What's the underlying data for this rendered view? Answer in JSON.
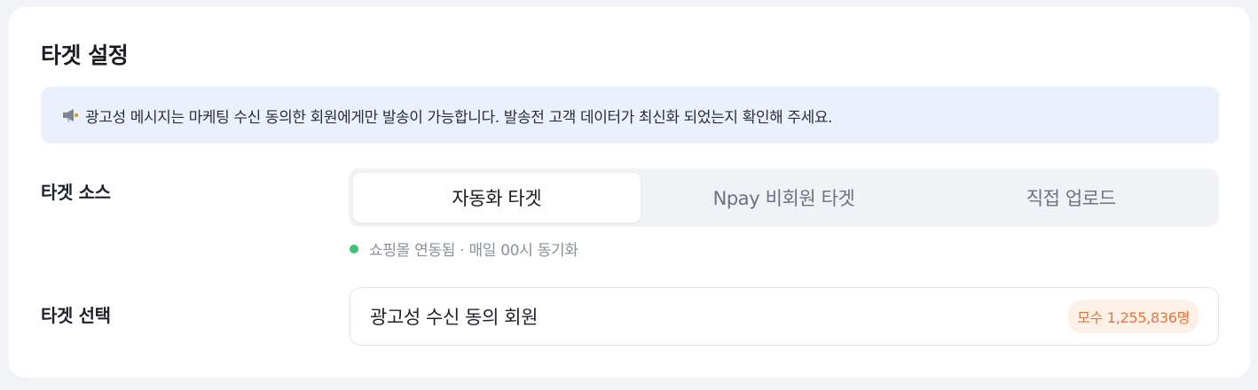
{
  "section": {
    "title": "타겟 설정"
  },
  "notice": {
    "icon": "megaphone-icon",
    "text": "광고성 메시지는 마케팅 수신 동의한 회원에게만 발송이 가능합니다. 발송전 고객 데이터가 최신화 되었는지 확인해 주세요."
  },
  "target_source": {
    "label": "타겟 소스",
    "options": [
      {
        "label": "자동화 타겟",
        "selected": true
      },
      {
        "label": "Npay 비회원 타겟",
        "selected": false
      },
      {
        "label": "직접 업로드",
        "selected": false
      }
    ],
    "sync_status": "쇼핑몰 연동됨 · 매일 00시 동기화",
    "sync_color": "#3cc377"
  },
  "target_select": {
    "label": "타겟 선택",
    "value": "광고성 수신 동의 회원",
    "count_badge": "모수 1,255,836명"
  },
  "colors": {
    "notice_bg": "#eaf1fc",
    "badge_text": "#e8743b",
    "badge_bg": "#fdf0e6"
  }
}
